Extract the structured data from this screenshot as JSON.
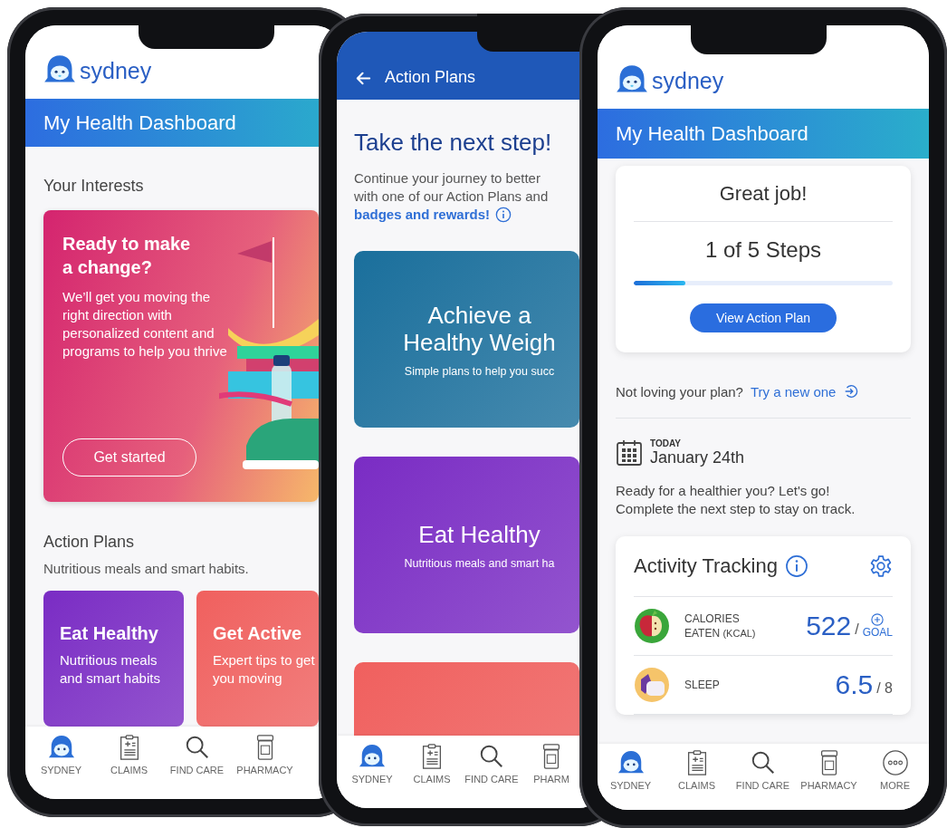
{
  "phones": [
    {
      "kind": "dashboard",
      "logo": "sydney",
      "header": "My Health Dashboard",
      "section_title": "Your Interests",
      "promo": {
        "title": "Ready to make a change?",
        "body": "We’ll get you moving the right direction with personalized content and programs to help you thrive",
        "button": "Get started"
      },
      "plans_title": "Action Plans",
      "plans_subtitle": "Nutritious meals and smart habits.",
      "plans": [
        {
          "title": "Eat Healthy",
          "body": "Nutritious meals and smart habits",
          "color": "#7a2cc4"
        },
        {
          "title": "Get Active",
          "body": "Expert tips to get you moving",
          "color": "#f0605e"
        }
      ],
      "tabs": [
        {
          "label": "SYDNEY"
        },
        {
          "label": "CLAIMS"
        },
        {
          "label": "FIND CARE"
        },
        {
          "label": "PHARMACY"
        }
      ]
    },
    {
      "kind": "action_plans",
      "header": "Action Plans",
      "title": "Take the next step!",
      "intro_lines": [
        "Continue your journey to better",
        "with one of our Action Plans and"
      ],
      "link": "badges and rewards!",
      "plans": [
        {
          "title_lines": [
            "Achieve a",
            "Healthy Weigh"
          ],
          "subtitle": "Simple plans to help you succ",
          "color": "#1a6f9c"
        },
        {
          "title_lines": [
            "Eat Healthy"
          ],
          "subtitle": "Nutritious meals and smart ha",
          "color": "#7a2cc4"
        },
        {
          "color": "#f0605e"
        }
      ],
      "tabs": [
        {
          "label": "SYDNEY"
        },
        {
          "label": "CLAIMS"
        },
        {
          "label": "FIND CARE"
        },
        {
          "label": "PHARM"
        }
      ]
    },
    {
      "kind": "tracker",
      "logo": "sydney",
      "header": "My Health Dashboard",
      "progress": {
        "title": "Great job!",
        "steps": "1 of 5 Steps",
        "level": 0.2,
        "button": "View Action Plan"
      },
      "prompt": "Not loving your plan?",
      "prompt_link": "Try a new one",
      "date_label": "TODAY",
      "date": "January 24th",
      "message_lines": [
        "Ready for a healthier you? Let's go!",
        "Complete the next step to stay on track."
      ],
      "activity_title": "Activity Tracking",
      "rows": [
        {
          "kind": "goal",
          "label": "CALORIES",
          "label2": "EATEN",
          "unit": "(KCAL)",
          "value": "522",
          "separator": "/",
          "goal": "GOAL"
        },
        {
          "kind": "target",
          "label": "SLEEP",
          "value": "6.5",
          "target": "/ 8"
        }
      ],
      "tabs": [
        {
          "label": "SYDNEY"
        },
        {
          "label": "CLAIMS"
        },
        {
          "label": "FIND CARE"
        },
        {
          "label": "PHARMACY"
        },
        {
          "label": "MORE"
        }
      ]
    }
  ]
}
